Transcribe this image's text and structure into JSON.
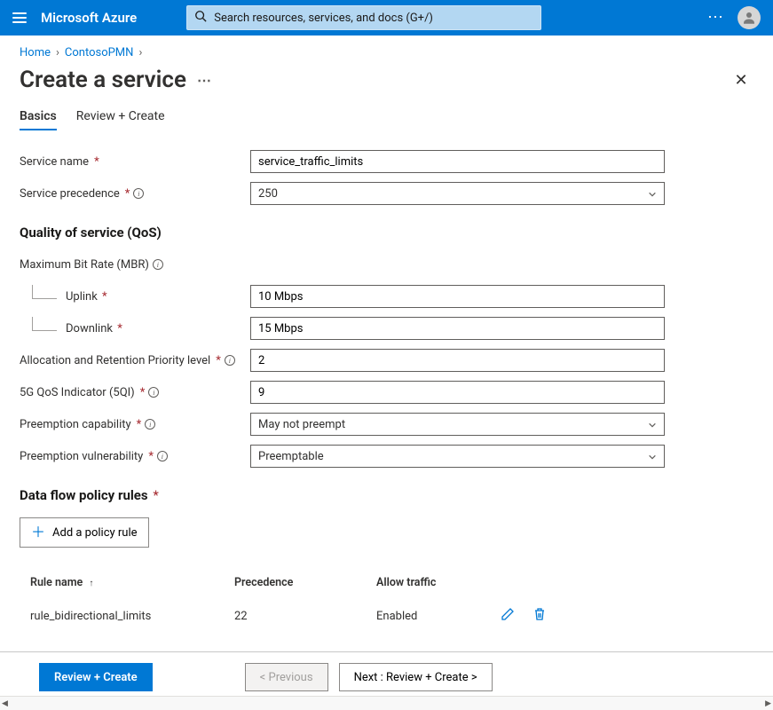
{
  "header": {
    "brand": "Microsoft Azure",
    "searchPlaceholder": "Search resources, services, and docs (G+/)"
  },
  "breadcrumb": {
    "items": [
      "Home",
      "ContosoPMN"
    ]
  },
  "page": {
    "title": "Create a service"
  },
  "tabs": {
    "basics": "Basics",
    "reviewCreate": "Review + Create"
  },
  "form": {
    "serviceNameLabel": "Service name",
    "serviceNameValue": "service_traffic_limits",
    "servicePrecedenceLabel": "Service precedence",
    "servicePrecedenceValue": "250",
    "qosTitle": "Quality of service (QoS)",
    "mbrLabel": "Maximum Bit Rate (MBR)",
    "uplinkLabel": "Uplink",
    "uplinkValue": "10 Mbps",
    "downlinkLabel": "Downlink",
    "downlinkValue": "15 Mbps",
    "arpLabel": "Allocation and Retention Priority level",
    "arpValue": "2",
    "fiveQiLabel": "5G QoS Indicator (5QI)",
    "fiveQiValue": "9",
    "preemptCapLabel": "Preemption capability",
    "preemptCapValue": "May not preempt",
    "preemptVulnLabel": "Preemption vulnerability",
    "preemptVulnValue": "Preemptable",
    "dataFlowTitle": "Data flow policy rules",
    "addRuleLabel": "Add a policy rule"
  },
  "rulesTable": {
    "cols": {
      "name": "Rule name",
      "precedence": "Precedence",
      "allow": "Allow traffic"
    },
    "rows": [
      {
        "name": "rule_bidirectional_limits",
        "precedence": "22",
        "allow": "Enabled"
      }
    ]
  },
  "footer": {
    "reviewCreate": "Review + Create",
    "previous": "< Previous",
    "next": "Next : Review + Create >"
  }
}
